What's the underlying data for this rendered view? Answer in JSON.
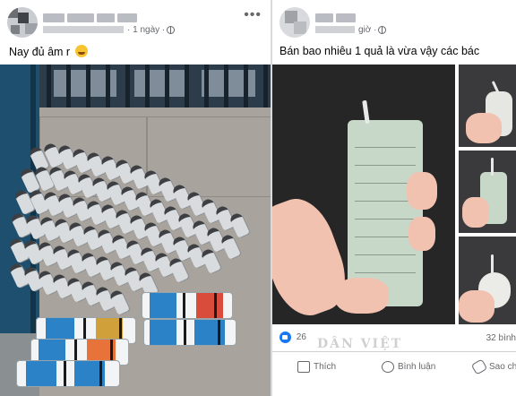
{
  "left_post": {
    "time": "1 ngày",
    "caption": "Nay đủ âm r",
    "emoji": "grinning-face-emoji"
  },
  "right_post": {
    "time": "giờ",
    "caption": "Bán bao nhiêu 1 quả là vừa vậy các bác",
    "reaction_count": "26",
    "comments_count": "32 bình",
    "watermark": "DÂN VIỆT",
    "actions": {
      "like": "Thích",
      "comment": "Bình luận",
      "share": "Sao ch"
    }
  },
  "icons": [
    "globe-icon",
    "more-options-icon",
    "like-icon",
    "comment-icon",
    "share-icon"
  ],
  "colors": {
    "facebook_blue": "#1877f2",
    "secondary_text": "#65676b",
    "primary_text": "#050505"
  }
}
